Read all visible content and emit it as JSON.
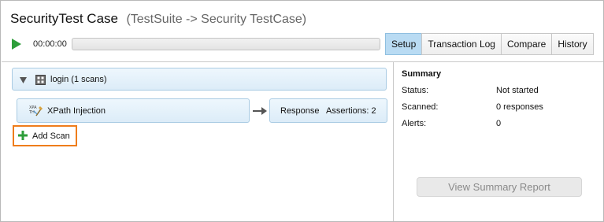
{
  "title": {
    "main": "SecurityTest Case",
    "sub": "(TestSuite -> Security TestCase)"
  },
  "toolbar": {
    "timer": "00:00:00",
    "progress_fraction": 0,
    "play_icon": "play-icon"
  },
  "tabs": [
    {
      "label": "Setup",
      "active": true
    },
    {
      "label": "Transaction Log",
      "active": false
    },
    {
      "label": "Compare",
      "active": false
    },
    {
      "label": "History",
      "active": false
    }
  ],
  "scan_group": {
    "label": "login (1 scans)",
    "icon": "testcase-icon",
    "expanded": true
  },
  "scan": {
    "label": "XPath Injection",
    "icon": "xpath-icon"
  },
  "response": {
    "label": "Response",
    "assertions": "Assertions: 2"
  },
  "add_scan": {
    "label": "Add Scan",
    "icon": "plus-icon"
  },
  "summary": {
    "title": "Summary",
    "rows": [
      {
        "label": "Status:",
        "value": "Not started"
      },
      {
        "label": "Scanned:",
        "value": "0 responses"
      },
      {
        "label": "Alerts:",
        "value": "0"
      }
    ],
    "report_button": "View Summary Report"
  },
  "colors": {
    "accent_tab": "#b9dbf3",
    "highlight": "#ef7d1b",
    "play": "#2e9e3a"
  }
}
